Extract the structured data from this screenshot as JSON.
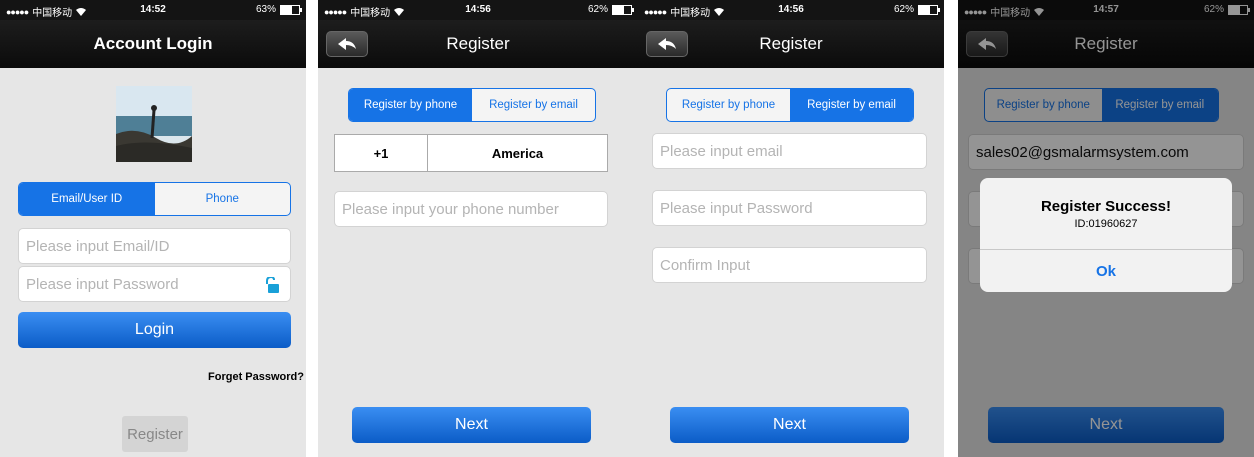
{
  "status": {
    "dots": "●●●●●",
    "carrier": "中国移动",
    "wifi": "wifi-icon",
    "s1": {
      "time": "14:52",
      "battery": "63%"
    },
    "s2": {
      "time": "14:56",
      "battery": "62%"
    },
    "s3": {
      "time": "14:56",
      "battery": "62%"
    },
    "s4": {
      "time": "14:57",
      "battery": "62%"
    }
  },
  "login": {
    "title": "Account Login",
    "tab_email": "Email/User ID",
    "tab_phone": "Phone",
    "email_placeholder": "Please input Email/ID",
    "password_placeholder": "Please input Password",
    "login_button": "Login",
    "forget_password": "Forget Password?",
    "register_button": "Register"
  },
  "register_phone": {
    "title": "Register",
    "tab_phone": "Register by phone",
    "tab_email": "Register by email",
    "country_code": "+1",
    "country_name": "America",
    "phone_placeholder": "Please input your phone number",
    "next_button": "Next"
  },
  "register_email": {
    "title": "Register",
    "tab_phone": "Register by phone",
    "tab_email": "Register by email",
    "email_placeholder": "Please input email",
    "password_placeholder": "Please input Password",
    "confirm_placeholder": "Confirm Input",
    "next_button": "Next"
  },
  "register_success": {
    "title": "Register",
    "tab_phone": "Register by phone",
    "tab_email": "Register by email",
    "email_value": "sales02@gsmalarmsystem.com",
    "alert_title": "Register Success!",
    "alert_message": "ID:01960627",
    "ok_button": "Ok",
    "next_button": "Next"
  },
  "colors": {
    "accent": "#1673e6",
    "navbar": "#141414",
    "background": "#e6e6e6"
  }
}
